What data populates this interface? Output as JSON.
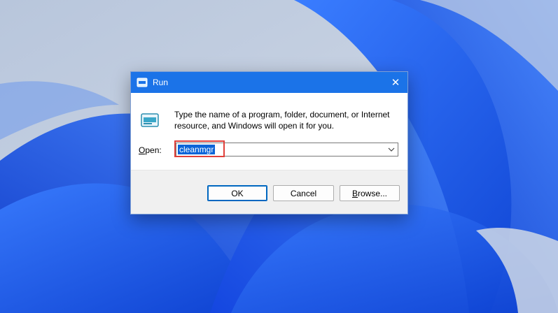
{
  "dialog": {
    "title": "Run",
    "close_glyph": "✕",
    "description": "Type the name of a program, folder, document, or Internet resource, and Windows will open it for you.",
    "open_label_prefix": "",
    "open_label_accesskey": "O",
    "open_label_rest": "pen:",
    "input_value": "cleanmgr",
    "buttons": {
      "ok": "OK",
      "cancel": "Cancel",
      "browse_accesskey": "B",
      "browse_rest": "rowse..."
    }
  },
  "icons": {
    "title_icon": "run-icon",
    "big_icon": "run-icon",
    "close_icon": "close-icon",
    "dropdown_icon": "chevron-down-icon"
  },
  "colors": {
    "titlebar": "#1b73e8",
    "selection": "#0a64d8",
    "highlight": "#e0403a",
    "wallpaper_blue": "#1e5ee8"
  }
}
